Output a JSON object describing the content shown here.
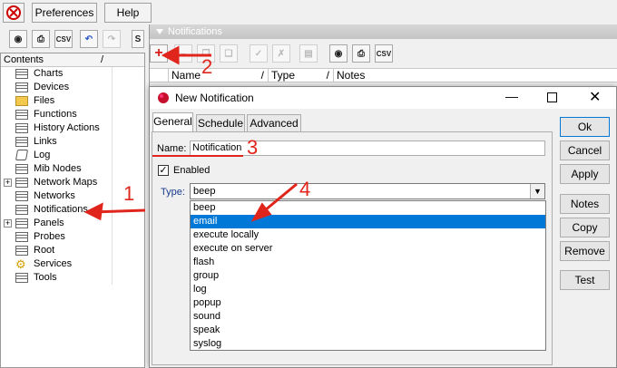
{
  "menubar": {
    "preferences": "Preferences",
    "help": "Help"
  },
  "toolbar": {
    "csv": "CSV",
    "extra": "S"
  },
  "tree": {
    "header": "Contents",
    "items": [
      {
        "label": "Charts"
      },
      {
        "label": "Devices"
      },
      {
        "label": "Files"
      },
      {
        "label": "Functions"
      },
      {
        "label": "History Actions"
      },
      {
        "label": "Links"
      },
      {
        "label": "Log"
      },
      {
        "label": "Mib Nodes"
      },
      {
        "label": "Network Maps"
      },
      {
        "label": "Networks"
      },
      {
        "label": "Notifications"
      },
      {
        "label": "Panels"
      },
      {
        "label": "Probes"
      },
      {
        "label": "Root"
      },
      {
        "label": "Services"
      },
      {
        "label": "Tools"
      }
    ]
  },
  "notifications": {
    "title": "Notifications",
    "columns": [
      "Name",
      "Type",
      "Notes"
    ],
    "csv": "CSV"
  },
  "dialog": {
    "title": "New Notification",
    "tabs": [
      "General",
      "Schedule",
      "Advanced"
    ],
    "name_label": "Name:",
    "name_value": "Notification",
    "enabled_label": "Enabled",
    "type_label": "Type:",
    "type_value": "beep",
    "options": [
      "beep",
      "email",
      "execute locally",
      "execute on server",
      "flash",
      "group",
      "log",
      "popup",
      "sound",
      "speak",
      "syslog"
    ],
    "selected_index": 1,
    "buttons": [
      "Ok",
      "Cancel",
      "Apply",
      "Notes",
      "Copy",
      "Remove",
      "Test"
    ]
  },
  "annotations": [
    "1",
    "2",
    "3",
    "4"
  ],
  "colors": {
    "annotation": "#e0251c",
    "selection": "#0078d7",
    "add_icon": "#d62020"
  }
}
